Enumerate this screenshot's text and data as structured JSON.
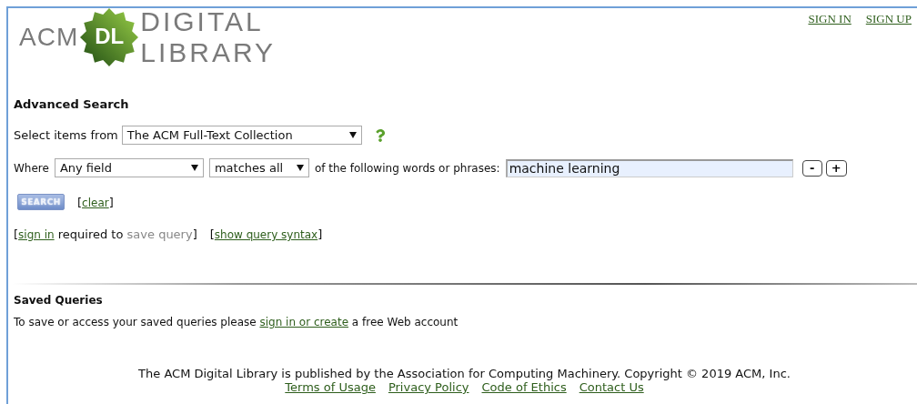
{
  "logo": {
    "left": "ACM",
    "badge": "DL",
    "line_1": "DIGITAL",
    "line_2": "LIBRARY"
  },
  "account_links": [
    "SIGN IN",
    "SIGN UP"
  ],
  "title": "Advanced Search",
  "collection": {
    "label": "Select items from",
    "value": "The ACM Full-Text Collection"
  },
  "query": {
    "label": "Where",
    "field": "Any field",
    "match": "matches all",
    "middle": "of the following words or phrases:",
    "value": "machine learning",
    "buttons": [
      "-",
      "+"
    ]
  },
  "search_button": "SEARCH",
  "clear": {
    "open": "[",
    "link": "clear",
    "close": "]"
  },
  "query_notes": [
    [
      {
        "kind": "text",
        "text": "["
      },
      {
        "kind": "link",
        "text": "sign in"
      },
      {
        "kind": "text",
        "text": " required to "
      },
      {
        "kind": "disabled",
        "text": "save query"
      },
      {
        "kind": "text",
        "text": "]"
      }
    ],
    [
      {
        "kind": "text",
        "text": "["
      },
      {
        "kind": "link",
        "text": "show query syntax"
      },
      {
        "kind": "text",
        "text": "]"
      }
    ]
  ],
  "saved": {
    "title": "Saved Queries",
    "text": [
      {
        "kind": "text",
        "text": "To save or access your saved queries please "
      },
      {
        "kind": "link",
        "text": "sign in or create"
      },
      {
        "kind": "text",
        "text": " a free Web account"
      }
    ]
  },
  "footer": {
    "text": "The ACM Digital Library is published by the Association for Computing Machinery. Copyright © 2019 ACM, Inc.",
    "links": [
      "Terms of Usage",
      "Privacy Policy",
      "Code of Ethics",
      "Contact Us"
    ]
  }
}
